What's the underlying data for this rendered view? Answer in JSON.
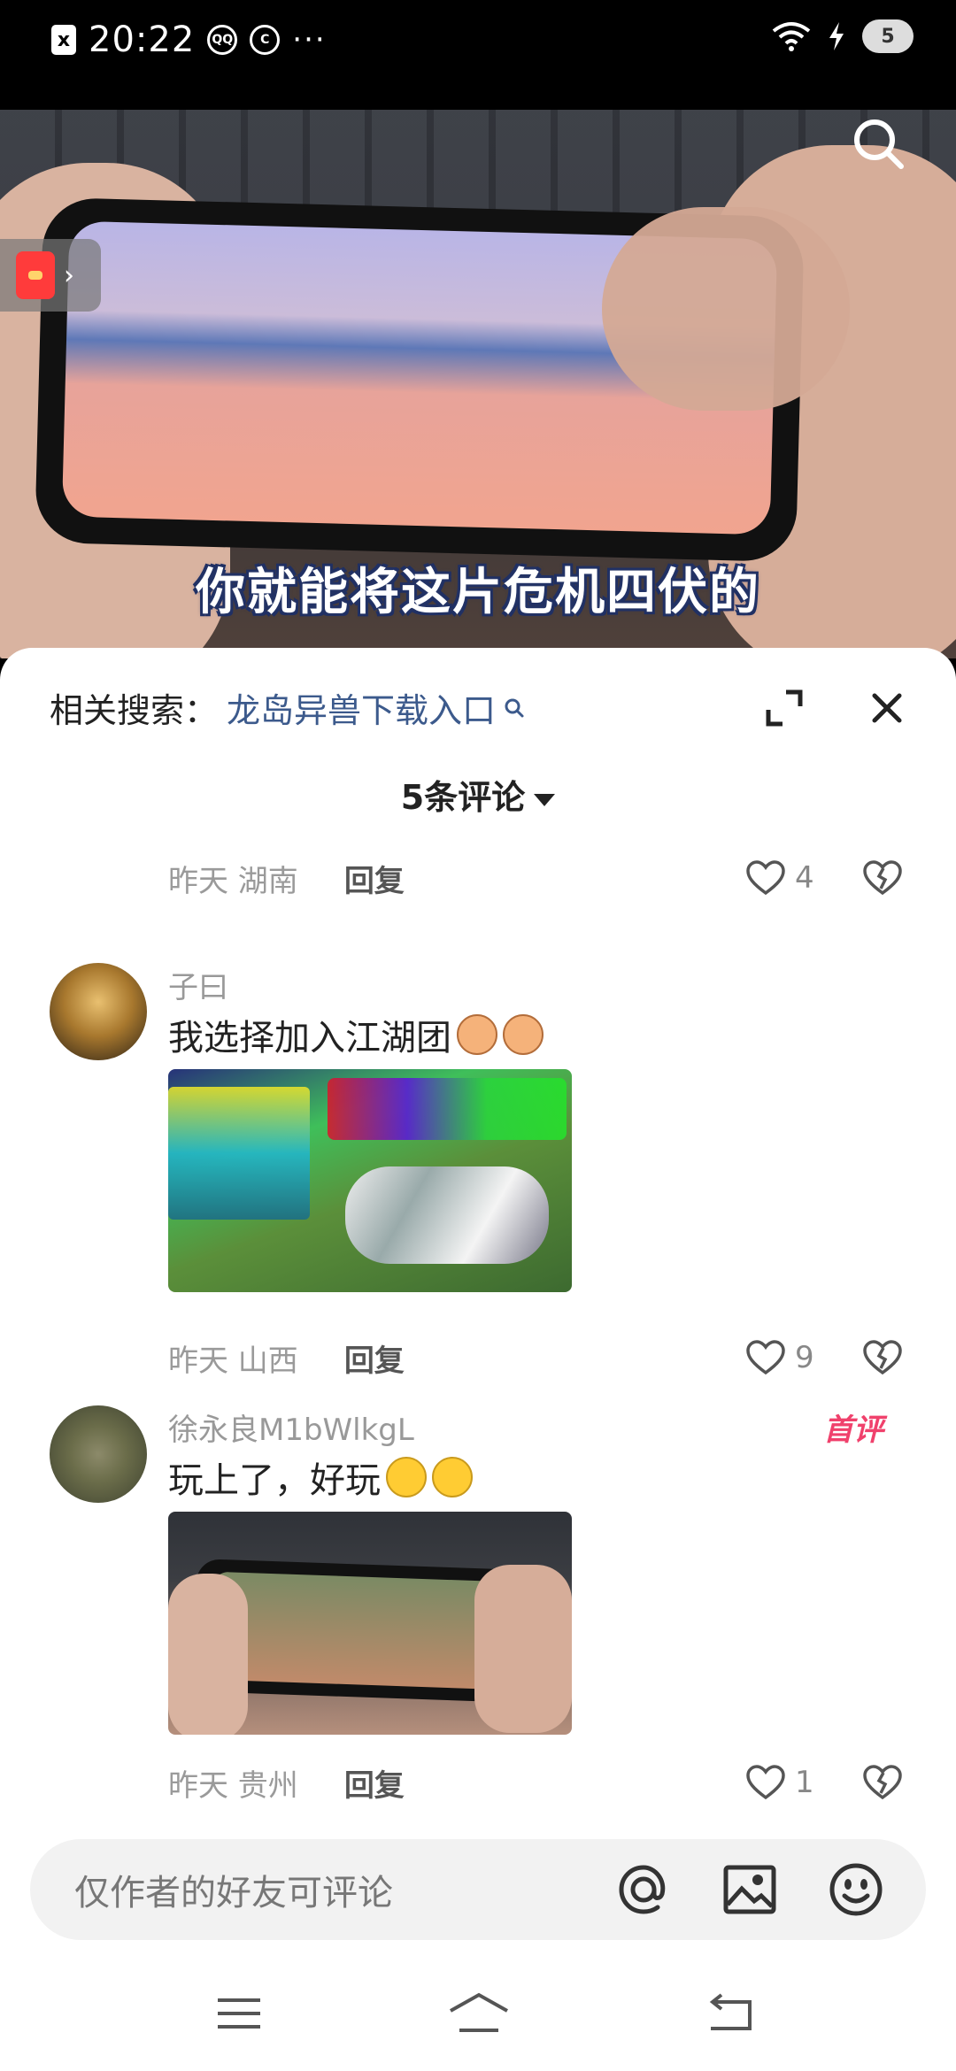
{
  "status_bar": {
    "x_label": "x",
    "time": "20:22",
    "app_icon_1": "QQ",
    "app_icon_2": "C",
    "dots": "···",
    "battery": "5"
  },
  "video": {
    "subtitle": "你就能将这片危机四伏的"
  },
  "sheet": {
    "related_prefix": "相关搜索：",
    "related_link": "龙岛异兽下载入口",
    "count_title": "5条评论"
  },
  "comments": [
    {
      "location_time": "昨天 湖南",
      "reply": "回复",
      "likes": "4"
    },
    {
      "username": "子曰",
      "text": "我选择加入江湖团",
      "emojis": [
        "cat-face",
        "cat-face"
      ],
      "location_time": "昨天 山西",
      "reply": "回复",
      "likes": "9"
    },
    {
      "username": "徐永良M1bWlkgL",
      "badge": "首评",
      "text": "玩上了，好玩",
      "emojis": [
        "grin",
        "grin"
      ],
      "location_time": "昨天 贵州",
      "reply": "回复",
      "likes": "1"
    }
  ],
  "input": {
    "placeholder": "仅作者的好友可评论"
  },
  "colors": {
    "link": "#3c5a8c",
    "badge": "#f0416c",
    "muted": "#9a9a9a"
  }
}
